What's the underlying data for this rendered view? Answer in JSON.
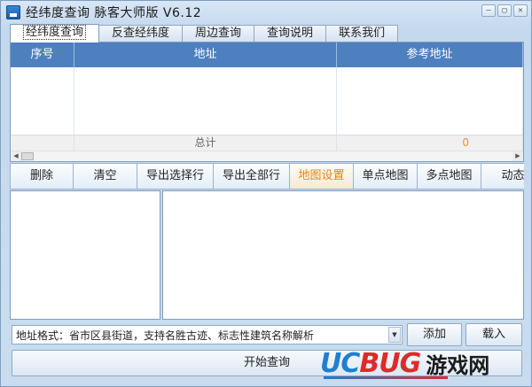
{
  "window": {
    "title": "经纬度查询 脉客大师版 V6.12",
    "controls": [
      "—",
      "▢",
      "✕"
    ]
  },
  "tabs": [
    {
      "label": "经纬度查询",
      "active": true
    },
    {
      "label": "反查经纬度",
      "active": false
    },
    {
      "label": "周边查询",
      "active": false
    },
    {
      "label": "查询说明",
      "active": false
    },
    {
      "label": "联系我们",
      "active": false
    }
  ],
  "grid": {
    "columns": [
      "序号",
      "地址",
      "参考地址"
    ],
    "footer": {
      "total_label": "总计",
      "total_value": "0"
    }
  },
  "toolbar": [
    "删除",
    "清空",
    "导出选择行",
    "导出全部行",
    "地图设置",
    "单点地图",
    "多点地图",
    "动态"
  ],
  "address": {
    "value": "地址格式：省市区县街道，支持名胜古迹、标志性建筑名称解析"
  },
  "buttons": {
    "add": "添加",
    "load": "载入",
    "start": "开始查询"
  },
  "watermark": {
    "uc": "UC",
    "bug": "BUG",
    "game": "游戏网"
  },
  "colors": {
    "header_blue": "#4e80c0",
    "highlight_orange": "#e8841a"
  }
}
